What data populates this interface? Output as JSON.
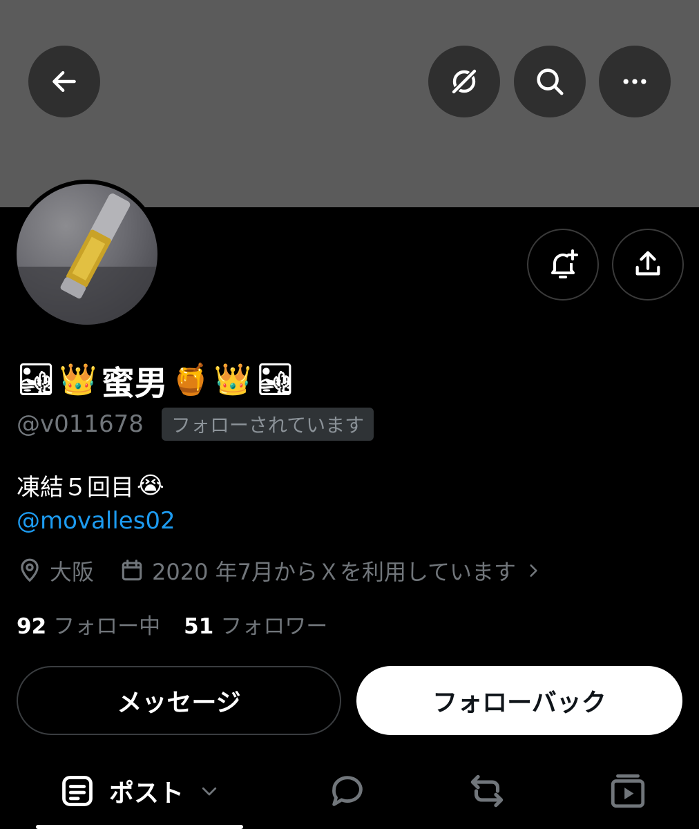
{
  "profile": {
    "display_name": "蜜男",
    "name_emojis_left": [
      "🏜",
      "👑"
    ],
    "name_emojis_right": [
      "🍯",
      "👑",
      "🏜"
    ],
    "handle": "@v011678",
    "follows_you_badge": "フォローされています",
    "bio_text": "凍結５回目",
    "bio_emoji": "😭",
    "bio_mention": "@movalles02",
    "location": "大阪",
    "joined": "2020 年7月からＸを利用しています",
    "following_count": "92",
    "following_label": "フォロー中",
    "followers_count": "51",
    "followers_label": "フォロワー"
  },
  "actions": {
    "message_label": "メッセージ",
    "follow_back_label": "フォローバック"
  },
  "tabs": {
    "posts_label": "ポスト"
  },
  "icons": {
    "back": "back-arrow-icon",
    "grok": "grok-icon",
    "search": "search-icon",
    "more": "more-icon",
    "notify": "bell-plus-icon",
    "share": "share-icon"
  },
  "colors": {
    "accent_link": "#1d9bf0",
    "banner": "#5b5b5b"
  }
}
